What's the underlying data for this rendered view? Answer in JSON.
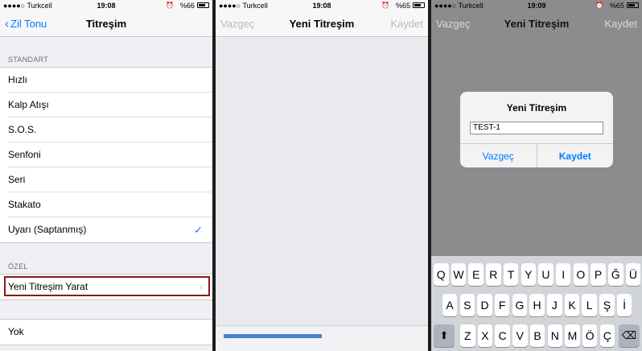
{
  "panel1": {
    "status": {
      "carrier": "●●●●○ Turkcell",
      "time": "19:08",
      "battery": "%66"
    },
    "nav": {
      "back_label": "Zil Tonu",
      "title": "Titreşim"
    },
    "standard_header": "STANDART",
    "standard_items": [
      "Hızlı",
      "Kalp Atışı",
      "S.O.S.",
      "Senfoni",
      "Seri",
      "Stakato",
      "Uyarı (Saptanmış)"
    ],
    "custom_header": "ÖZEL",
    "custom_item": "Yeni Titreşim Yarat",
    "none_item": "Yok"
  },
  "panel2": {
    "status": {
      "carrier": "●●●●○ Turkcell",
      "time": "19:08",
      "battery": "%65"
    },
    "nav": {
      "cancel_label": "Vazgeç",
      "title": "Yeni Titreşim",
      "save_label": "Kaydet"
    }
  },
  "panel3": {
    "status": {
      "carrier": "●●●●○ Turkcell",
      "time": "19:09",
      "battery": "%65"
    },
    "nav": {
      "cancel_label": "Vazgeç",
      "title": "Yeni Titreşim",
      "save_label": "Kaydet"
    },
    "alert": {
      "title": "Yeni Titreşim",
      "input_value": "TEST-1",
      "cancel_label": "Vazgeç",
      "save_label": "Kaydet"
    },
    "keyboard": {
      "row1": [
        "Q",
        "W",
        "E",
        "R",
        "T",
        "Y",
        "U",
        "I",
        "O",
        "P",
        "Ğ",
        "Ü"
      ],
      "row2": [
        "A",
        "S",
        "D",
        "F",
        "G",
        "H",
        "J",
        "K",
        "L",
        "Ş",
        "İ"
      ],
      "row3": [
        "Z",
        "X",
        "C",
        "V",
        "B",
        "N",
        "M",
        "Ö",
        "Ç"
      ]
    }
  },
  "colors": {
    "accent": "#007aff",
    "highlight": "#8b1a1a"
  },
  "icons": {
    "back": "chevron-left-icon",
    "check": "checkmark-icon",
    "shift": "shift-icon",
    "delete": "backspace-icon"
  }
}
